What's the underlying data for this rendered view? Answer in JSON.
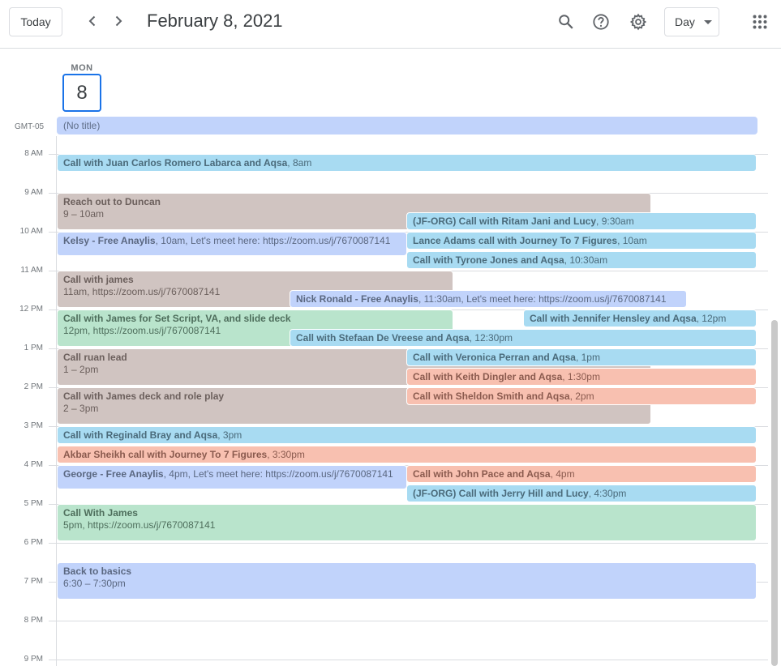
{
  "header": {
    "today_label": "Today",
    "date_title": "February 8, 2021",
    "view_label": "Day",
    "icons": [
      "chevron-left-icon",
      "chevron-right-icon",
      "search-icon",
      "help-icon",
      "settings-gear-icon",
      "apps-grid-icon"
    ]
  },
  "day": {
    "name": "MON",
    "number": "8",
    "timezone": "GMT-05"
  },
  "allday": {
    "title": "(No title)"
  },
  "hours": [
    "8 AM",
    "9 AM",
    "10 AM",
    "11 AM",
    "12 PM",
    "1 PM",
    "2 PM",
    "3 PM",
    "4 PM",
    "5 PM",
    "6 PM",
    "7 PM",
    "8 PM",
    "9 PM"
  ],
  "colors": {
    "blue_light": "#a8dbf2",
    "lavender": "#c1d3fb",
    "taupe": "#d0c4c1",
    "green": "#b9e4cc",
    "salmon": "#f8c0b0",
    "accent": "#1a73e8"
  },
  "events": [
    {
      "id": "e1",
      "title": "Call with Juan Carlos Romero Labarca and Aqsa",
      "time": ", 8am",
      "color": "#a8dbf2"
    },
    {
      "id": "e2",
      "title": "Reach out to Duncan",
      "time": "9 – 10am",
      "color": "#d0c4c1"
    },
    {
      "id": "e3",
      "title": "(JF-ORG) Call with Ritam Jani and Lucy",
      "time": ", 9:30am",
      "color": "#a8dbf2"
    },
    {
      "id": "e4",
      "title": "Kelsy - Free Anaylis",
      "time": ", 10am, Let's meet here: https://zoom.us/j/7670087141",
      "color": "#c1d3fb"
    },
    {
      "id": "e5",
      "title": "Lance Adams call with Journey To 7 Figures",
      "time": ", 10am",
      "color": "#a8dbf2"
    },
    {
      "id": "e6",
      "title": "Call with Tyrone Jones and Aqsa",
      "time": ", 10:30am",
      "color": "#a8dbf2"
    },
    {
      "id": "e7",
      "title": "Call with james",
      "time": "11am, https://zoom.us/j/7670087141",
      "color": "#d0c4c1"
    },
    {
      "id": "e8",
      "title": "Nick Ronald - Free Anaylis",
      "time": ", 11:30am, Let's meet here: https://zoom.us/j/7670087141",
      "color": "#c1d3fb"
    },
    {
      "id": "e9",
      "title": "Call with James for Set Script, VA, and slide deck",
      "time": "12pm, https://zoom.us/j/7670087141",
      "color": "#b9e4cc"
    },
    {
      "id": "e10",
      "title": "Call with Jennifer Hensley and Aqsa",
      "time": ", 12pm",
      "color": "#a8dbf2"
    },
    {
      "id": "e11",
      "title": "Call with Stefaan De Vreese and Aqsa",
      "time": ", 12:30pm",
      "color": "#a8dbf2"
    },
    {
      "id": "e12",
      "title": "Call ruan lead",
      "time": "1 – 2pm",
      "color": "#d0c4c1"
    },
    {
      "id": "e13",
      "title": "Call with Veronica Perran and Aqsa",
      "time": ", 1pm",
      "color": "#a8dbf2"
    },
    {
      "id": "e14",
      "title": "Call with Keith Dingler and Aqsa",
      "time": ", 1:30pm",
      "color": "#f8c0b0"
    },
    {
      "id": "e15",
      "title": "Call with James deck and role play",
      "time": "2 – 3pm",
      "color": "#d0c4c1"
    },
    {
      "id": "e16",
      "title": "Call with Sheldon Smith and Aqsa",
      "time": ", 2pm",
      "color": "#f8c0b0"
    },
    {
      "id": "e17",
      "title": "Call with Reginald Bray and Aqsa",
      "time": ", 3pm",
      "color": "#a8dbf2"
    },
    {
      "id": "e18",
      "title": "Akbar Sheikh call with Journey To 7 Figures",
      "time": ", 3:30pm",
      "color": "#f8c0b0"
    },
    {
      "id": "e19",
      "title": "George - Free Anaylis",
      "time": ", 4pm, Let's meet here: https://zoom.us/j/7670087141",
      "color": "#c1d3fb"
    },
    {
      "id": "e20",
      "title": "Call with John Pace and Aqsa",
      "time": ", 4pm",
      "color": "#f8c0b0"
    },
    {
      "id": "e21",
      "title": "(JF-ORG) Call with Jerry Hill and Lucy",
      "time": ", 4:30pm",
      "color": "#a8dbf2"
    },
    {
      "id": "e22",
      "title": "Call With James",
      "time": "5pm, https://zoom.us/j/7670087141",
      "color": "#b9e4cc"
    },
    {
      "id": "e23",
      "title": "Back to basics",
      "time": "6:30 – 7:30pm",
      "color": "#c1d3fb"
    }
  ]
}
